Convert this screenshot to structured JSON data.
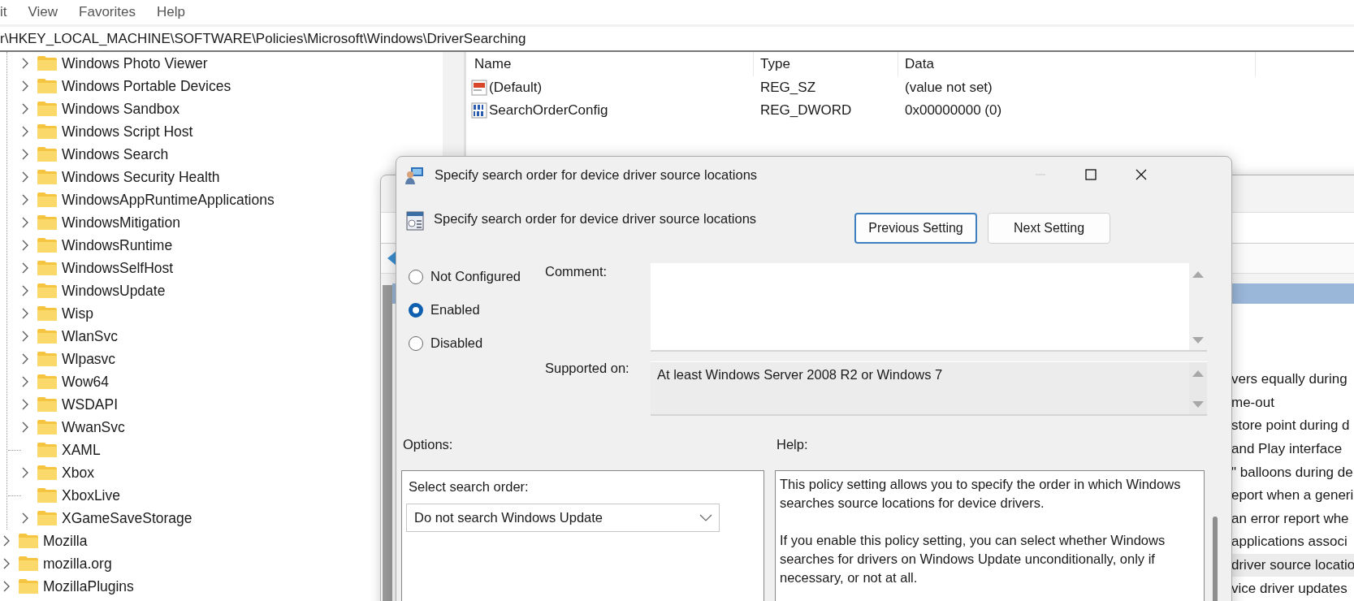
{
  "registry_editor": {
    "menu": [
      "it",
      "View",
      "Favorites",
      "Help"
    ],
    "address": "r\\HKEY_LOCAL_MACHINE\\SOFTWARE\\Policies\\Microsoft\\Windows\\DriverSearching",
    "tree": [
      {
        "children": [
          {
            "name": "Windows Photo Viewer",
            "expandable": true
          },
          {
            "name": "Windows Portable Devices",
            "expandable": true
          },
          {
            "name": "Windows Sandbox",
            "expandable": true
          },
          {
            "name": "Windows Script Host",
            "expandable": true
          },
          {
            "name": "Windows Search",
            "expandable": true
          },
          {
            "name": "Windows Security Health",
            "expandable": true
          },
          {
            "name": "WindowsAppRuntimeApplications",
            "expandable": true
          },
          {
            "name": "WindowsMitigation",
            "expandable": true
          },
          {
            "name": "WindowsRuntime",
            "expandable": true
          },
          {
            "name": "WindowsSelfHost",
            "expandable": true
          },
          {
            "name": "WindowsUpdate",
            "expandable": true
          },
          {
            "name": "Wisp",
            "expandable": true
          },
          {
            "name": "WlanSvc",
            "expandable": true
          },
          {
            "name": "Wlpasvc",
            "expandable": true
          },
          {
            "name": "Wow64",
            "expandable": true
          },
          {
            "name": "WSDAPI",
            "expandable": true
          },
          {
            "name": "WwanSvc",
            "expandable": true
          },
          {
            "name": "XAML",
            "expandable": false
          },
          {
            "name": "Xbox",
            "expandable": true
          },
          {
            "name": "XboxLive",
            "expandable": false
          },
          {
            "name": "XGameSaveStorage",
            "expandable": true
          }
        ]
      },
      {
        "name": "Mozilla",
        "expandable": true
      },
      {
        "name": "mozilla.org",
        "expandable": true
      },
      {
        "name": "MozillaPlugins",
        "expandable": true
      }
    ],
    "values": {
      "columns": [
        "Name",
        "Type",
        "Data"
      ],
      "rows": [
        {
          "kind": "string",
          "name": "(Default)",
          "type": "REG_SZ",
          "data": "(value not set)"
        },
        {
          "kind": "binary",
          "name": "SearchOrderConfig",
          "type": "REG_DWORD",
          "data": "0x00000000 (0)"
        }
      ]
    }
  },
  "policy_editor": {
    "settings": [
      {
        "text": "vers equally during",
        "selected": false
      },
      {
        "text": "me-out",
        "selected": false
      },
      {
        "text": "store point during d",
        "selected": false
      },
      {
        "text": "and Play interface",
        "selected": false
      },
      {
        "text": "\" balloons during de",
        "selected": false
      },
      {
        "text": "eport when a generi",
        "selected": false
      },
      {
        "text": "an error report whe",
        "selected": false
      },
      {
        "text": "applications associ",
        "selected": false
      },
      {
        "text": "driver source locatio",
        "selected": true
      },
      {
        "text": "vice driver updates",
        "selected": false
      }
    ]
  },
  "dialog": {
    "title": "Specify search order for device driver source locations",
    "minimize_disabled": true,
    "setting_name": "Specify search order for device driver source locations",
    "buttons": [
      {
        "label": "Previous Setting",
        "focused": true
      },
      {
        "label": "Next Setting",
        "focused": false
      }
    ],
    "states": [
      {
        "label": "Not Configured",
        "selected": false
      },
      {
        "label": "Enabled",
        "selected": true
      },
      {
        "label": "Disabled",
        "selected": false
      }
    ],
    "comment_label": "Comment:",
    "supported_label": "Supported on:",
    "supported_value": "At least Windows Server 2008 R2 or Windows 7",
    "options_label": "Options:",
    "help_label": "Help:",
    "option": {
      "label": "Select search order:",
      "value": "Do not search Windows Update"
    },
    "help": [
      "This policy setting allows you to specify the order in which Windows searches source locations for device drivers.",
      "If you enable this policy setting, you can select whether Windows searches for drivers on Windows Update unconditionally, only if necessary, or not at all."
    ]
  }
}
